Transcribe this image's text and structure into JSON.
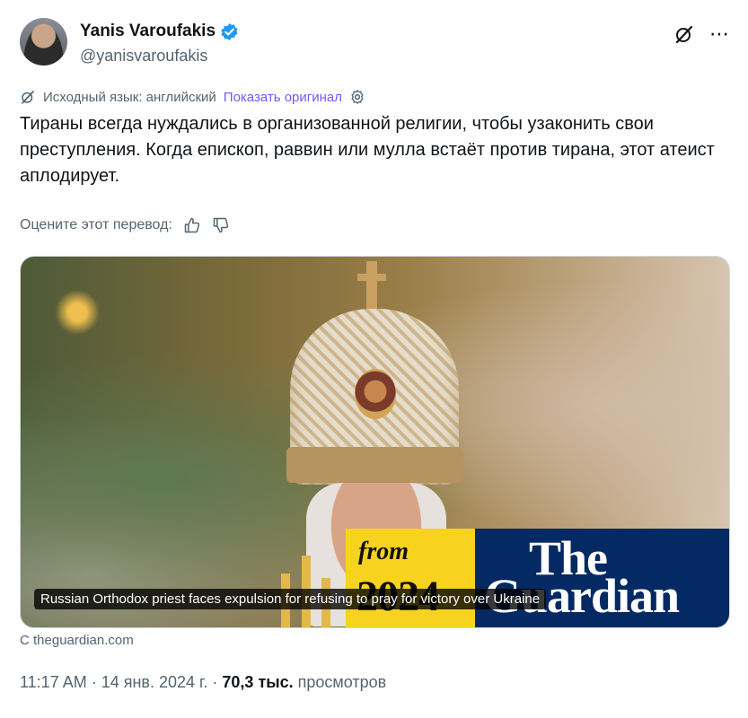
{
  "author": {
    "name": "Yanis Varoufakis",
    "handle": "@yanisvaroufakis",
    "verified": true,
    "verified_color": "#1d9bf0"
  },
  "header_icons": [
    "grok-icon",
    "more-icon"
  ],
  "translation": {
    "source_label": "Исходный язык: английский",
    "show_original": "Показать оригинал",
    "link_color": "#7856ff"
  },
  "tweet": {
    "text": "Тираны всегда нуждались в организованной религии, чтобы узаконить свои преступления. Когда епископ, раввин или мулла встаёт против тирана, этот атеист аплодирует."
  },
  "rating": {
    "label": "Оцените этот перевод:"
  },
  "card": {
    "badge_from": "from",
    "badge_year": "2024",
    "badge_brand_1": "The",
    "badge_brand_2": "Guardian",
    "caption": "Russian Orthodox priest faces expulsion for refusing to pray for victory over Ukraine",
    "source": "С theguardian.com",
    "yellow": "#f7d21f",
    "blue": "#052962"
  },
  "meta": {
    "time": "11:17 AM",
    "sep1": "·",
    "date": "14 янв. 2024 г.",
    "sep2": "·",
    "views": "70,3 тыс.",
    "views_label": "просмотров"
  }
}
